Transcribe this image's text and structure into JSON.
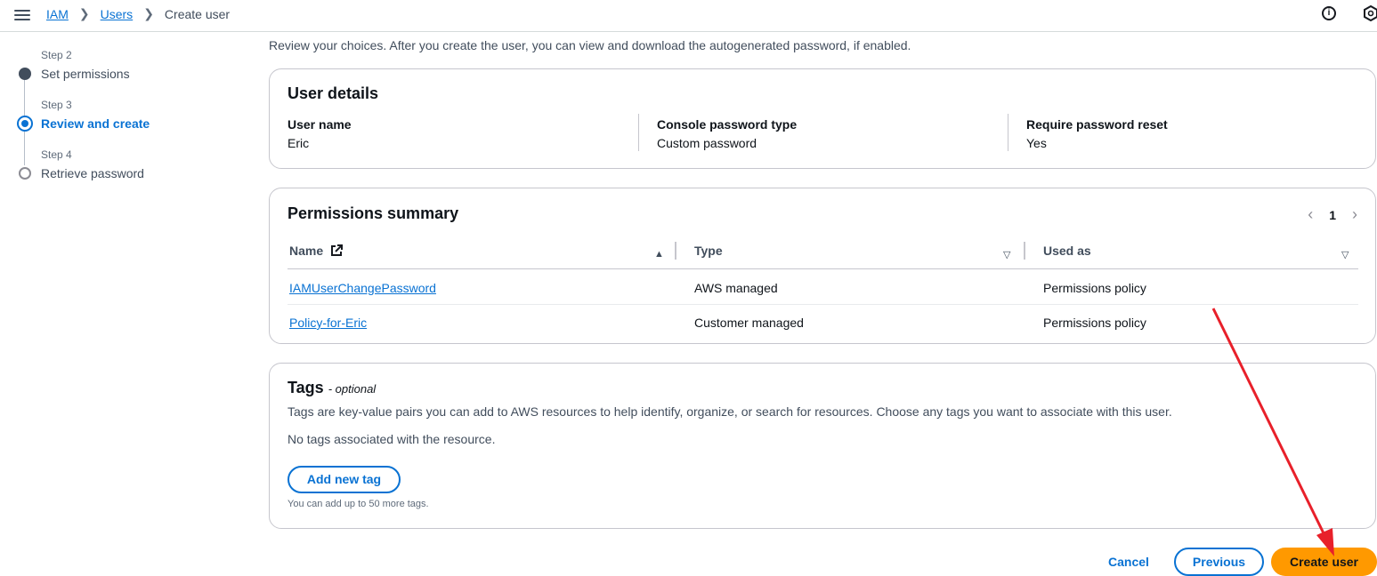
{
  "breadcrumb": {
    "items": [
      "IAM",
      "Users"
    ],
    "current": "Create user"
  },
  "steps": [
    {
      "num": "Step 2",
      "label": "Set permissions",
      "state": "done"
    },
    {
      "num": "Step 3",
      "label": "Review and create",
      "state": "active"
    },
    {
      "num": "Step 4",
      "label": "Retrieve password",
      "state": "pending"
    }
  ],
  "intro": "Review your choices. After you create the user, you can view and download the autogenerated password, if enabled.",
  "user_details": {
    "title": "User details",
    "fields": [
      {
        "label": "User name",
        "value": "Eric"
      },
      {
        "label": "Console password type",
        "value": "Custom password"
      },
      {
        "label": "Require password reset",
        "value": "Yes"
      }
    ]
  },
  "permissions": {
    "title": "Permissions summary",
    "page": "1",
    "columns": [
      "Name",
      "Type",
      "Used as"
    ],
    "rows": [
      {
        "name": "IAMUserChangePassword",
        "type": "AWS managed",
        "used_as": "Permissions policy"
      },
      {
        "name": "Policy-for-Eric",
        "type": "Customer managed",
        "used_as": "Permissions policy"
      }
    ]
  },
  "tags": {
    "title": "Tags",
    "optional": "- optional",
    "description": "Tags are key-value pairs you can add to AWS resources to help identify, organize, or search for resources. Choose any tags you want to associate with this user.",
    "empty": "No tags associated with the resource.",
    "add_button": "Add new tag",
    "hint": "You can add up to 50 more tags."
  },
  "footer": {
    "cancel": "Cancel",
    "previous": "Previous",
    "create": "Create user"
  },
  "colors": {
    "link": "#0972d3",
    "primary": "#ff9900",
    "arrow": "#e8202a"
  },
  "icons": [
    "menu-icon",
    "chevron-right-icon",
    "info-icon",
    "hexagon-icon",
    "external-link-icon",
    "sort-ascending-icon",
    "sort-descending-icon",
    "chevron-left-icon"
  ]
}
